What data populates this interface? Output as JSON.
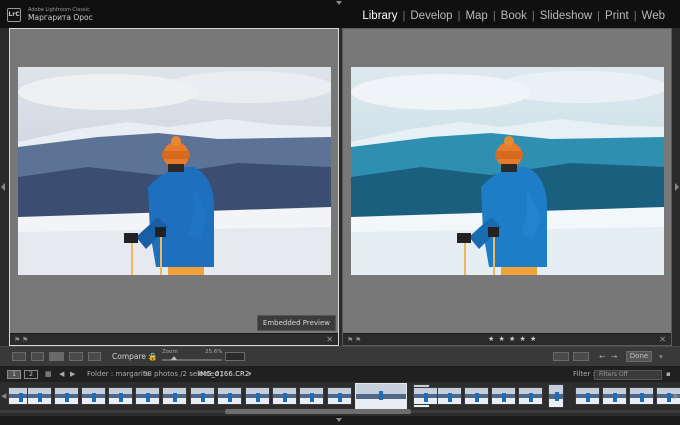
{
  "app": {
    "logo": "LrC",
    "product": "Adobe Lightroom Classic",
    "user": "Маргарита Орос"
  },
  "modules": [
    "Library",
    "Develop",
    "Map",
    "Book",
    "Slideshow",
    "Print",
    "Web"
  ],
  "active_module": "Library",
  "compare": {
    "left_strip_label": "",
    "right_rating": "★ ★ ★ ★ ★",
    "embedded_preview": "Embedded Preview"
  },
  "toolbar": {
    "compare_label": "Compare :",
    "zoom_label": "Zoom",
    "zoom_value": "25.6%",
    "zoom_fraction": 0.2,
    "done_label": "Done"
  },
  "filmstrip_header": {
    "screen1": "1",
    "screen2": "2",
    "folder_prefix": "Folder : margarita",
    "count": "98 photos /2 selected /",
    "filename": "IMG_0166.CR2",
    "filter_label": "Filter :",
    "filter_value": "Filters Off"
  },
  "colors": {
    "accent_active": "#ffffff",
    "panel_bg": "#787878",
    "header_bg": "#101010"
  },
  "icons": [
    "chevron-down-icon",
    "flag-icon",
    "close-icon",
    "grid-view-icon",
    "loupe-view-icon",
    "compare-view-icon",
    "survey-view-icon",
    "people-view-icon",
    "lock-icon",
    "prev-icon",
    "next-icon"
  ]
}
